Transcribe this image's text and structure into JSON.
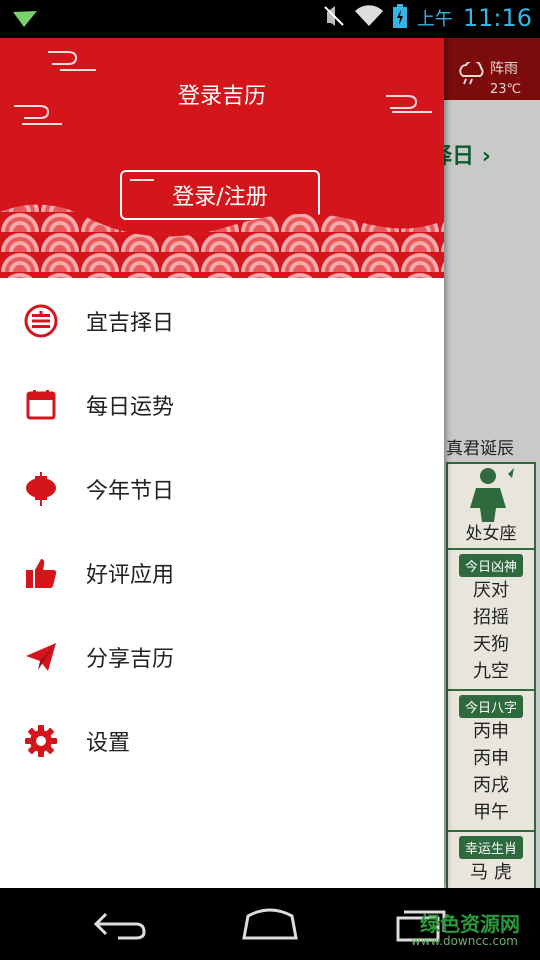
{
  "status_bar": {
    "ampm": "上午",
    "time": "11:16",
    "icons": [
      "notification-icon",
      "mute-icon",
      "wifi-icon",
      "battery-charging-icon"
    ]
  },
  "background": {
    "weather_condition": "阵雨",
    "weather_temp": "23℃",
    "zeri_label": "择日",
    "birthday_label": "真君诞辰",
    "zodiac_label": "处女座",
    "sections": [
      {
        "badge": "今日凶神",
        "items": [
          "厌对",
          "招摇",
          "天狗",
          "九空"
        ]
      },
      {
        "badge": "今日八字",
        "items": [
          "丙申",
          "丙申",
          "丙戌",
          "甲午"
        ]
      },
      {
        "badge": "幸运生肖",
        "items": [
          "马 虎"
        ]
      }
    ]
  },
  "drawer": {
    "title": "登录吉历",
    "login_button": "登录/注册",
    "accent_color": "#d4161c",
    "menu": [
      {
        "label": "宜吉择日",
        "icon": "calendar-auspicious-icon"
      },
      {
        "label": "每日运势",
        "icon": "daily-calendar-icon"
      },
      {
        "label": "今年节日",
        "icon": "lantern-icon"
      },
      {
        "label": "好评应用",
        "icon": "thumbs-up-icon"
      },
      {
        "label": "分享吉历",
        "icon": "paper-plane-icon"
      },
      {
        "label": "设置",
        "icon": "gear-icon"
      }
    ]
  },
  "navbar": {
    "watermark": "绿色资源网",
    "watermark_url": "www.downcc.com"
  }
}
